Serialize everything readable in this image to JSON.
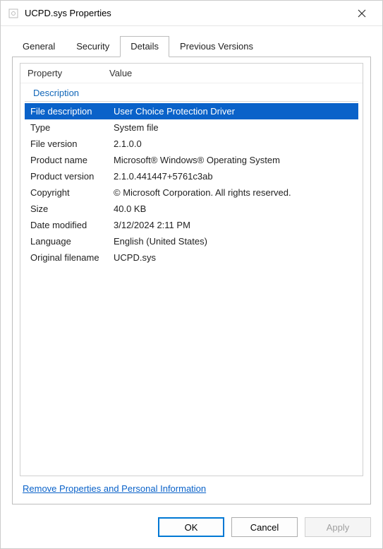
{
  "window": {
    "title": "UCPD.sys Properties"
  },
  "tabs": {
    "general": "General",
    "security": "Security",
    "details": "Details",
    "previous": "Previous Versions"
  },
  "columns": {
    "property": "Property",
    "value": "Value"
  },
  "group": {
    "description": "Description"
  },
  "props": [
    {
      "name": "File description",
      "value": "User Choice Protection Driver",
      "selected": true
    },
    {
      "name": "Type",
      "value": "System file",
      "selected": false
    },
    {
      "name": "File version",
      "value": "2.1.0.0",
      "selected": false
    },
    {
      "name": "Product name",
      "value": "Microsoft® Windows® Operating System",
      "selected": false
    },
    {
      "name": "Product version",
      "value": "2.1.0.441447+5761c3ab",
      "selected": false
    },
    {
      "name": "Copyright",
      "value": "© Microsoft Corporation. All rights reserved.",
      "selected": false
    },
    {
      "name": "Size",
      "value": "40.0 KB",
      "selected": false
    },
    {
      "name": "Date modified",
      "value": "3/12/2024 2:11 PM",
      "selected": false
    },
    {
      "name": "Language",
      "value": "English (United States)",
      "selected": false
    },
    {
      "name": "Original filename",
      "value": "UCPD.sys",
      "selected": false
    }
  ],
  "link": {
    "remove": "Remove Properties and Personal Information"
  },
  "buttons": {
    "ok": "OK",
    "cancel": "Cancel",
    "apply": "Apply"
  }
}
